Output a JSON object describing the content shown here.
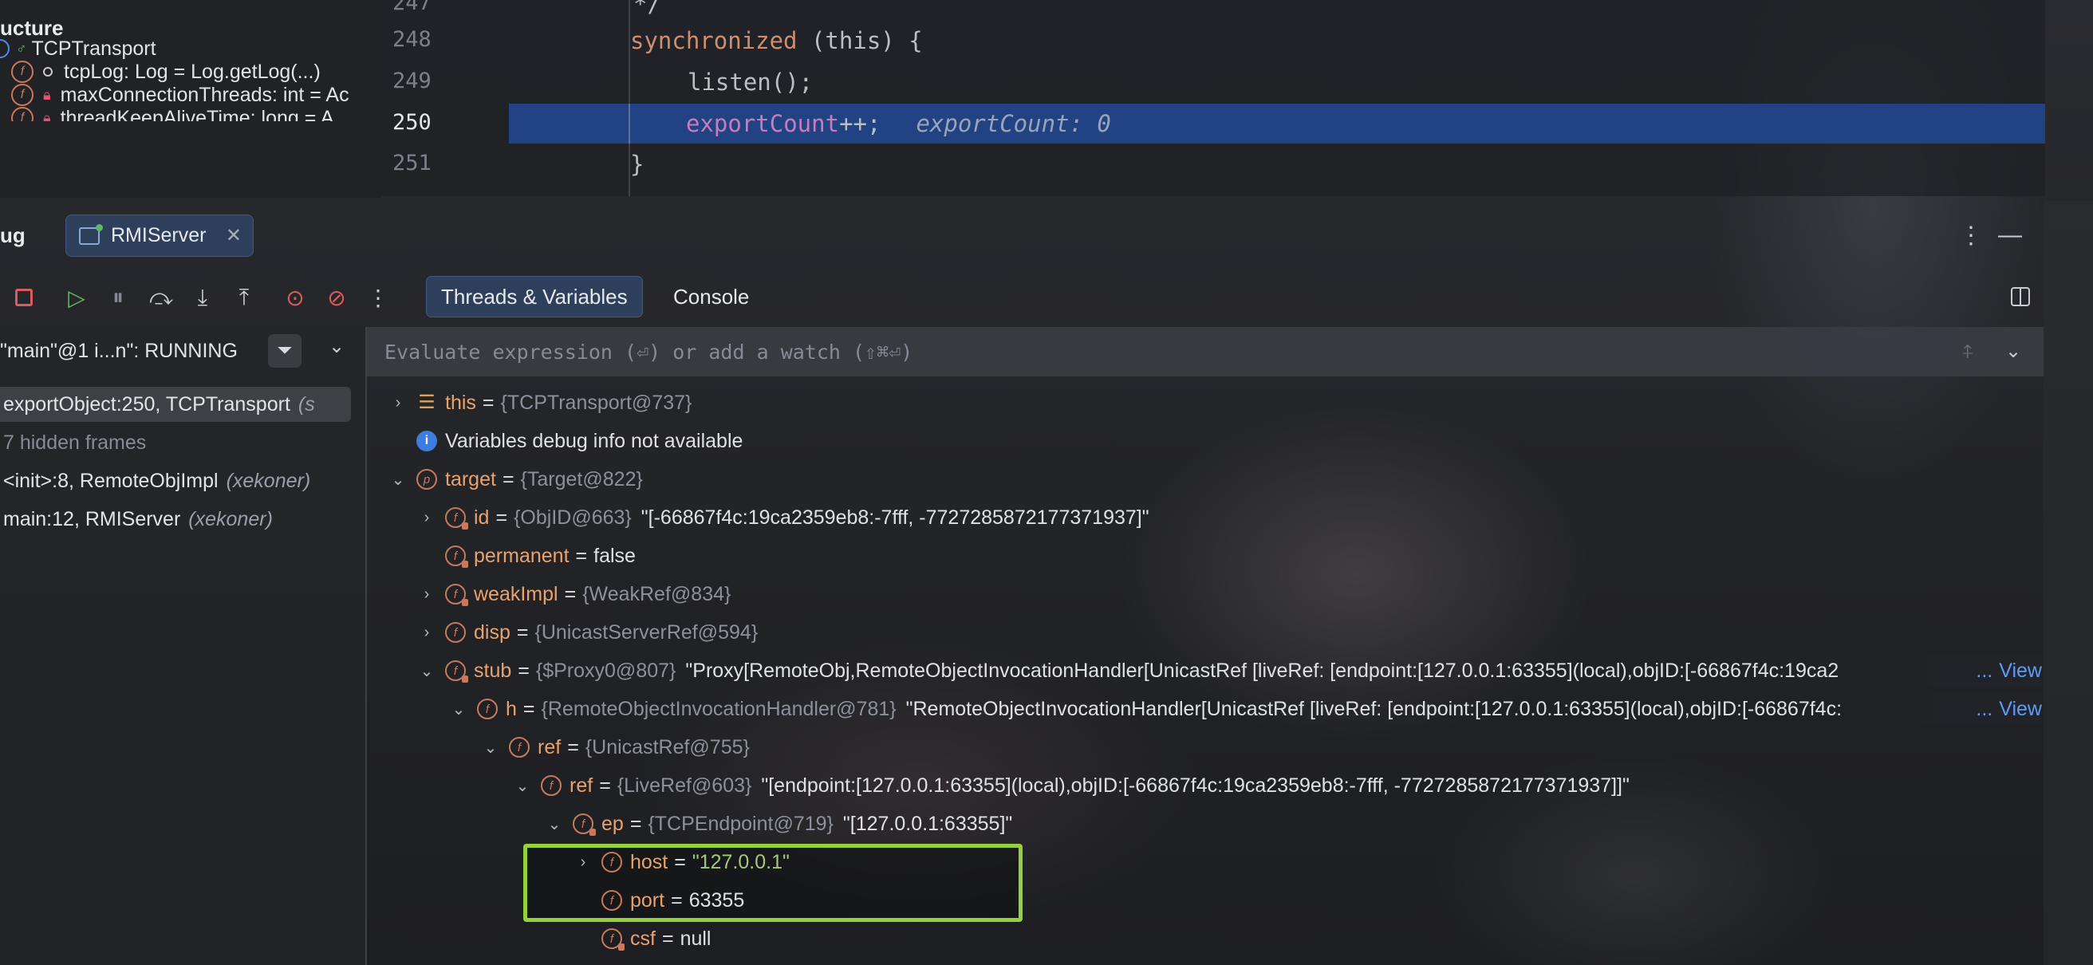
{
  "structure": {
    "title": "ucture",
    "items": [
      {
        "label": "TCPTransport"
      },
      {
        "label": "tcpLog: Log = Log.getLog(...)"
      },
      {
        "label": "maxConnectionThreads: int = Ac"
      },
      {
        "label": "threadKeepAliveTime: long = A"
      }
    ]
  },
  "editor": {
    "lines": [
      {
        "num": "247",
        "code": "*/"
      },
      {
        "num": "248",
        "kw": "synchronized",
        "rest": " (this) {"
      },
      {
        "num": "249",
        "code": "listen();"
      },
      {
        "num": "250",
        "field": "exportCount",
        "rest": "++;",
        "hint": "exportCount: 0"
      },
      {
        "num": "251",
        "code": "}"
      }
    ]
  },
  "debug": {
    "title": "ug",
    "run_tab": "RMIServer",
    "tabs": [
      "Threads & Variables",
      "Console"
    ],
    "thread": "\"main\"@1 i...n\": RUNNING",
    "frames": [
      {
        "method": "exportObject:250, TCPTransport",
        "loc": "(s"
      },
      {
        "method": "7 hidden frames",
        "loc": ""
      },
      {
        "method": "<init>:8, RemoteObjImpl",
        "loc": "(xekoner)"
      },
      {
        "method": "main:12, RMIServer",
        "loc": "(xekoner)"
      }
    ],
    "eval_placeholder": "Evaluate expression (⏎) or add a watch (⇧⌘⏎)"
  },
  "variables": {
    "view_label": "View",
    "ellipsis": "...",
    "rows": [
      {
        "name": "this",
        "type": "{TCPTransport@737}",
        "value": ""
      },
      {
        "name": "",
        "type": "",
        "value": "Variables debug info not available"
      },
      {
        "name": "target",
        "type": "{Target@822}",
        "value": ""
      },
      {
        "name": "id",
        "type": "{ObjID@663}",
        "value": "\"[-66867f4c:19ca2359eb8:-7fff, -7727285872177371937]\""
      },
      {
        "name": "permanent",
        "type": "",
        "value": "false"
      },
      {
        "name": "weakImpl",
        "type": "{WeakRef@834}",
        "value": ""
      },
      {
        "name": "disp",
        "type": "{UnicastServerRef@594}",
        "value": ""
      },
      {
        "name": "stub",
        "type": "{$Proxy0@807}",
        "value": "\"Proxy[RemoteObj,RemoteObjectInvocationHandler[UnicastRef [liveRef: [endpoint:[127.0.0.1:63355](local),objID:[-66867f4c:19ca2"
      },
      {
        "name": "h",
        "type": "{RemoteObjectInvocationHandler@781}",
        "value": "\"RemoteObjectInvocationHandler[UnicastRef [liveRef: [endpoint:[127.0.0.1:63355](local),objID:[-66867f4c:"
      },
      {
        "name": "ref",
        "type": "{UnicastRef@755}",
        "value": ""
      },
      {
        "name": "ref",
        "type": "{LiveRef@603}",
        "value": "\"[endpoint:[127.0.0.1:63355](local),objID:[-66867f4c:19ca2359eb8:-7fff, -7727285872177371937]]\""
      },
      {
        "name": "ep",
        "type": "{TCPEndpoint@719}",
        "value": "\"[127.0.0.1:63355]\""
      },
      {
        "name": "host",
        "type": "",
        "value": "\"127.0.0.1\""
      },
      {
        "name": "port",
        "type": "",
        "value": "63355"
      },
      {
        "name": "csf",
        "type": "",
        "value": "null"
      }
    ]
  }
}
